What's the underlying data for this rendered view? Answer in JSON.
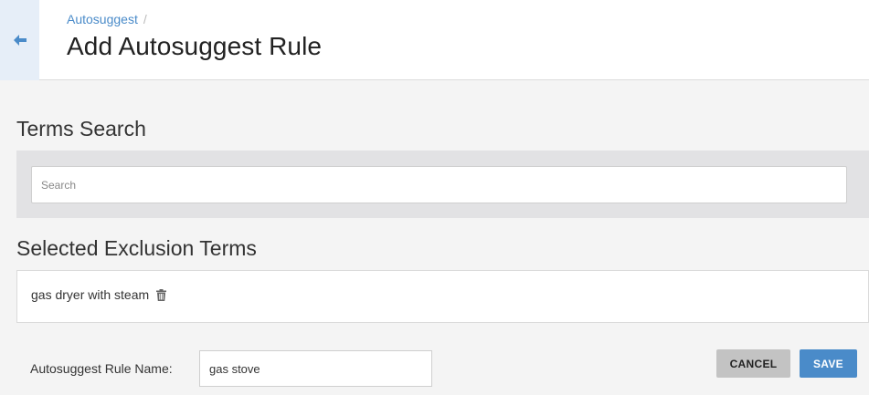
{
  "header": {
    "breadcrumb": {
      "link": "Autosuggest",
      "separator": "/"
    },
    "title": "Add Autosuggest Rule",
    "back_icon": "arrow-left-icon"
  },
  "terms_search": {
    "title": "Terms Search",
    "input": {
      "placeholder": "Search",
      "value": ""
    }
  },
  "exclusions": {
    "title": "Selected Exclusion Terms",
    "items": [
      {
        "label": "gas dryer with steam",
        "icon": "trash-icon"
      }
    ]
  },
  "rule_name": {
    "label": "Autosuggest Rule Name:",
    "value": "gas stove"
  },
  "actions": {
    "cancel_label": "CANCEL",
    "save_label": "SAVE"
  },
  "colors": {
    "accent": "#4a8bc9",
    "background": "#f4f4f4",
    "cancel_bg": "#c3c3c3",
    "back_bg": "#e6eef8"
  }
}
